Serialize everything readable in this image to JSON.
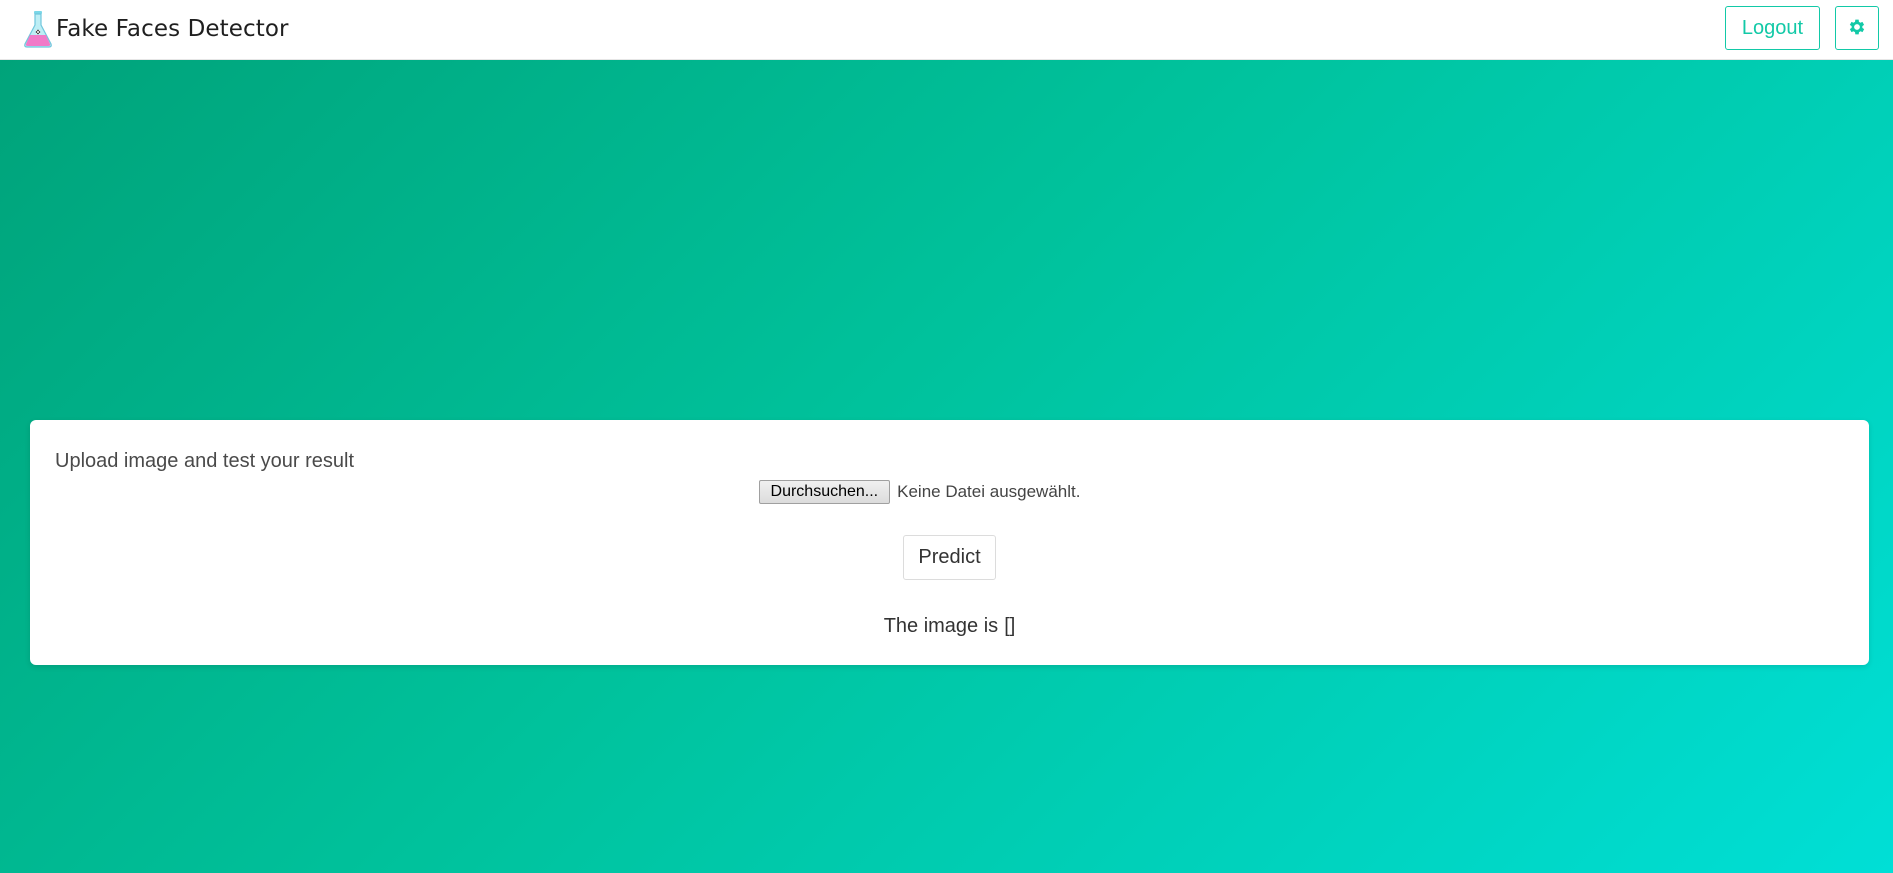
{
  "navbar": {
    "title": "Fake Faces Detector",
    "brand_icon": "flask-icon",
    "logout_label": "Logout",
    "settings_icon": "gear-icon"
  },
  "card": {
    "heading": "Upload image and test your result",
    "file_button_label": "Durchsuchen...",
    "file_status": "Keine Datei ausgewählt.",
    "predict_label": "Predict",
    "result_prefix": "The image is",
    "result_value": "[]"
  },
  "colors": {
    "accent": "#12c9a7",
    "gradient_start": "#00a37a",
    "gradient_end": "#00dfd6"
  }
}
